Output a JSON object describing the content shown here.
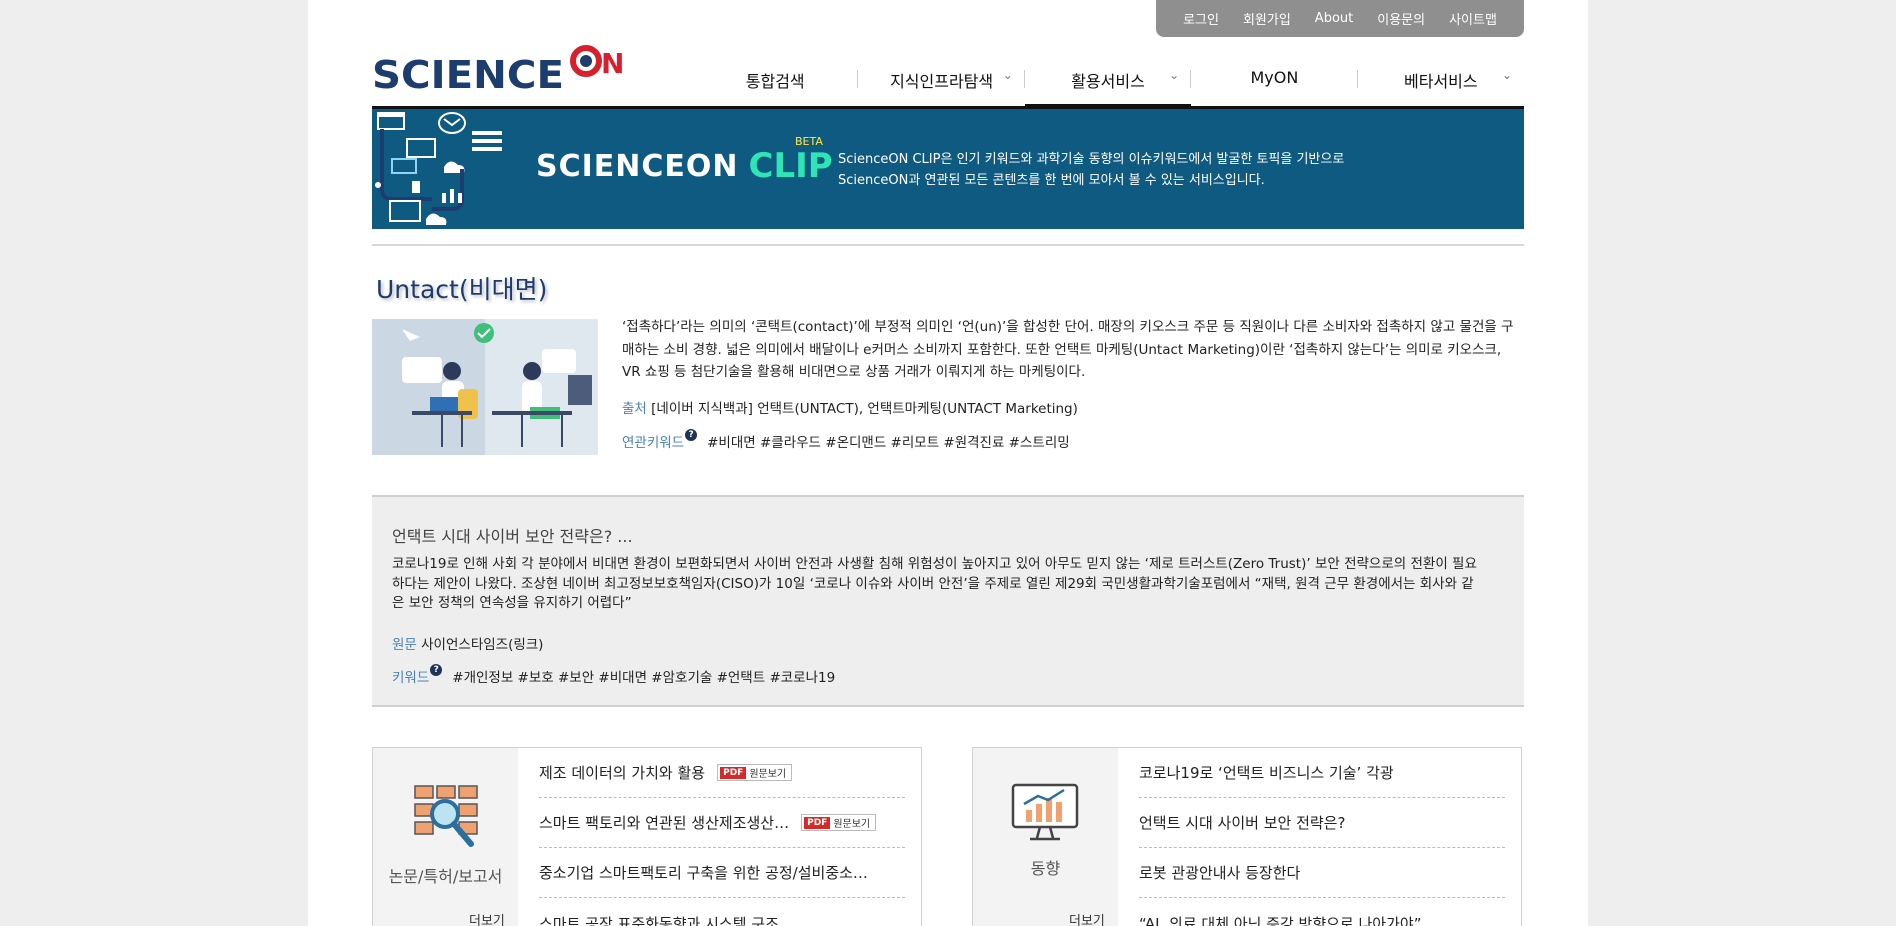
{
  "util_nav": [
    "로그인",
    "회원가입",
    "About",
    "이용문의",
    "사이트맵"
  ],
  "logo": {
    "text_main": "SCIENCE",
    "text_on": "ON"
  },
  "nav": [
    {
      "label": "통합검색",
      "has_dropdown": false,
      "active": false
    },
    {
      "label": "지식인프라탐색",
      "has_dropdown": true,
      "active": false
    },
    {
      "label": "활용서비스",
      "has_dropdown": true,
      "active": true
    },
    {
      "label": "MyON",
      "has_dropdown": false,
      "active": false
    },
    {
      "label": "베타서비스",
      "has_dropdown": true,
      "active": false
    }
  ],
  "banner": {
    "brand_main": "SCIENCEON",
    "brand_clip": "CLIP",
    "beta": "BETA",
    "desc_line1": "ScienceON CLIP은 인기 키워드와 과학기술 동향의 이슈키워드에서 발굴한 토픽을 기반으로",
    "desc_line2": "ScienceON과 연관된 모든 콘텐츠를 한 번에 모아서 볼 수 있는 서비스입니다."
  },
  "topic": {
    "title": "Untact(비대면)",
    "description": "‘접촉하다’라는 의미의 ‘콘택트(contact)’에 부정적 의미인 ‘언(un)’을 합성한 단어. 매장의 키오스크 주문 등 직원이나 다른 소비자와 접촉하지 않고 물건을 구매하는 소비 경향. 넓은 의미에서 배달이나 e커머스 소비까지 포함한다. 또한 언택트 마케팅(Untact Marketing)이란 ‘접촉하지 않는다’는 의미로 키오스크, VR 쇼핑 등 첨단기술을 활용해 비대면으로 상품 거래가 이뤄지게 하는 마케팅이다.",
    "source_label": "출처",
    "source_text": "[네이버 지식백과] 언택트(UNTACT), 언택트마케팅(UNTACT Marketing)",
    "keyword_label": "연관키워드",
    "keywords": "#비대면 #클라우드 #온디맨드 #리모트 #원격진료 #스트리밍"
  },
  "news": {
    "title": "언택트 시대 사이버 보안 전략은? ...",
    "body": "코로나19로 인해 사회 각 분야에서 비대면 환경이 보편화되면서 사이버 안전과 사생활 침해 위험성이 높아지고 있어 아무도 믿지 않는 ‘제로 트러스트(Zero Trust)’ 보안 전략으로의 전환이 필요하다는 제안이 나왔다. 조상현 네이버 최고정보보호책임자(CISO)가 10일 ‘코로나 이슈와 사이버 안전’을 주제로 열린 제29회 국민생활과학기술포럼에서 “재택, 원격 근무 환경에서는 회사와 같은 보안 정책의 연속성을 유지하기 어렵다”",
    "source_label": "원문",
    "source_text": "사이언스타임즈(링크)",
    "keyword_label": "키워드",
    "keywords": "#개인정보 #보호 #보안 #비대면 #암호기술 #언택트 #코로나19"
  },
  "panel_papers": {
    "label": "논문/특허/보고서",
    "more": "더보기",
    "pdf_label": "원문보기",
    "items": [
      {
        "title": "제조 데이터의 가치와 활용",
        "pdf": true
      },
      {
        "title": "스마트 팩토리와 연관된 생산제조생산…",
        "pdf": true
      },
      {
        "title": "중소기업 스마트팩토리 구축을 위한 공정/설비중소…",
        "pdf": false
      },
      {
        "title": "스마트 공장 표준화동향과 시스템 구조",
        "pdf": false
      }
    ]
  },
  "panel_trends": {
    "label": "동향",
    "more": "더보기",
    "items": [
      {
        "title": "코로나19로 ‘언택트 비즈니스 기술’ 각광"
      },
      {
        "title": "언택트 시대 사이버 보안 전략은?"
      },
      {
        "title": "로봇 관광안내사 등장한다"
      },
      {
        "title": "“AI, 의료 대체 아닌 증강 방향으로 나아가야”"
      }
    ]
  },
  "colors": {
    "banner_bg": "#0f5a81",
    "clip_green": "#2ee5b6",
    "logo_navy": "#1d3d6e",
    "logo_red": "#d7202e",
    "label_blue": "#4a82b8"
  }
}
